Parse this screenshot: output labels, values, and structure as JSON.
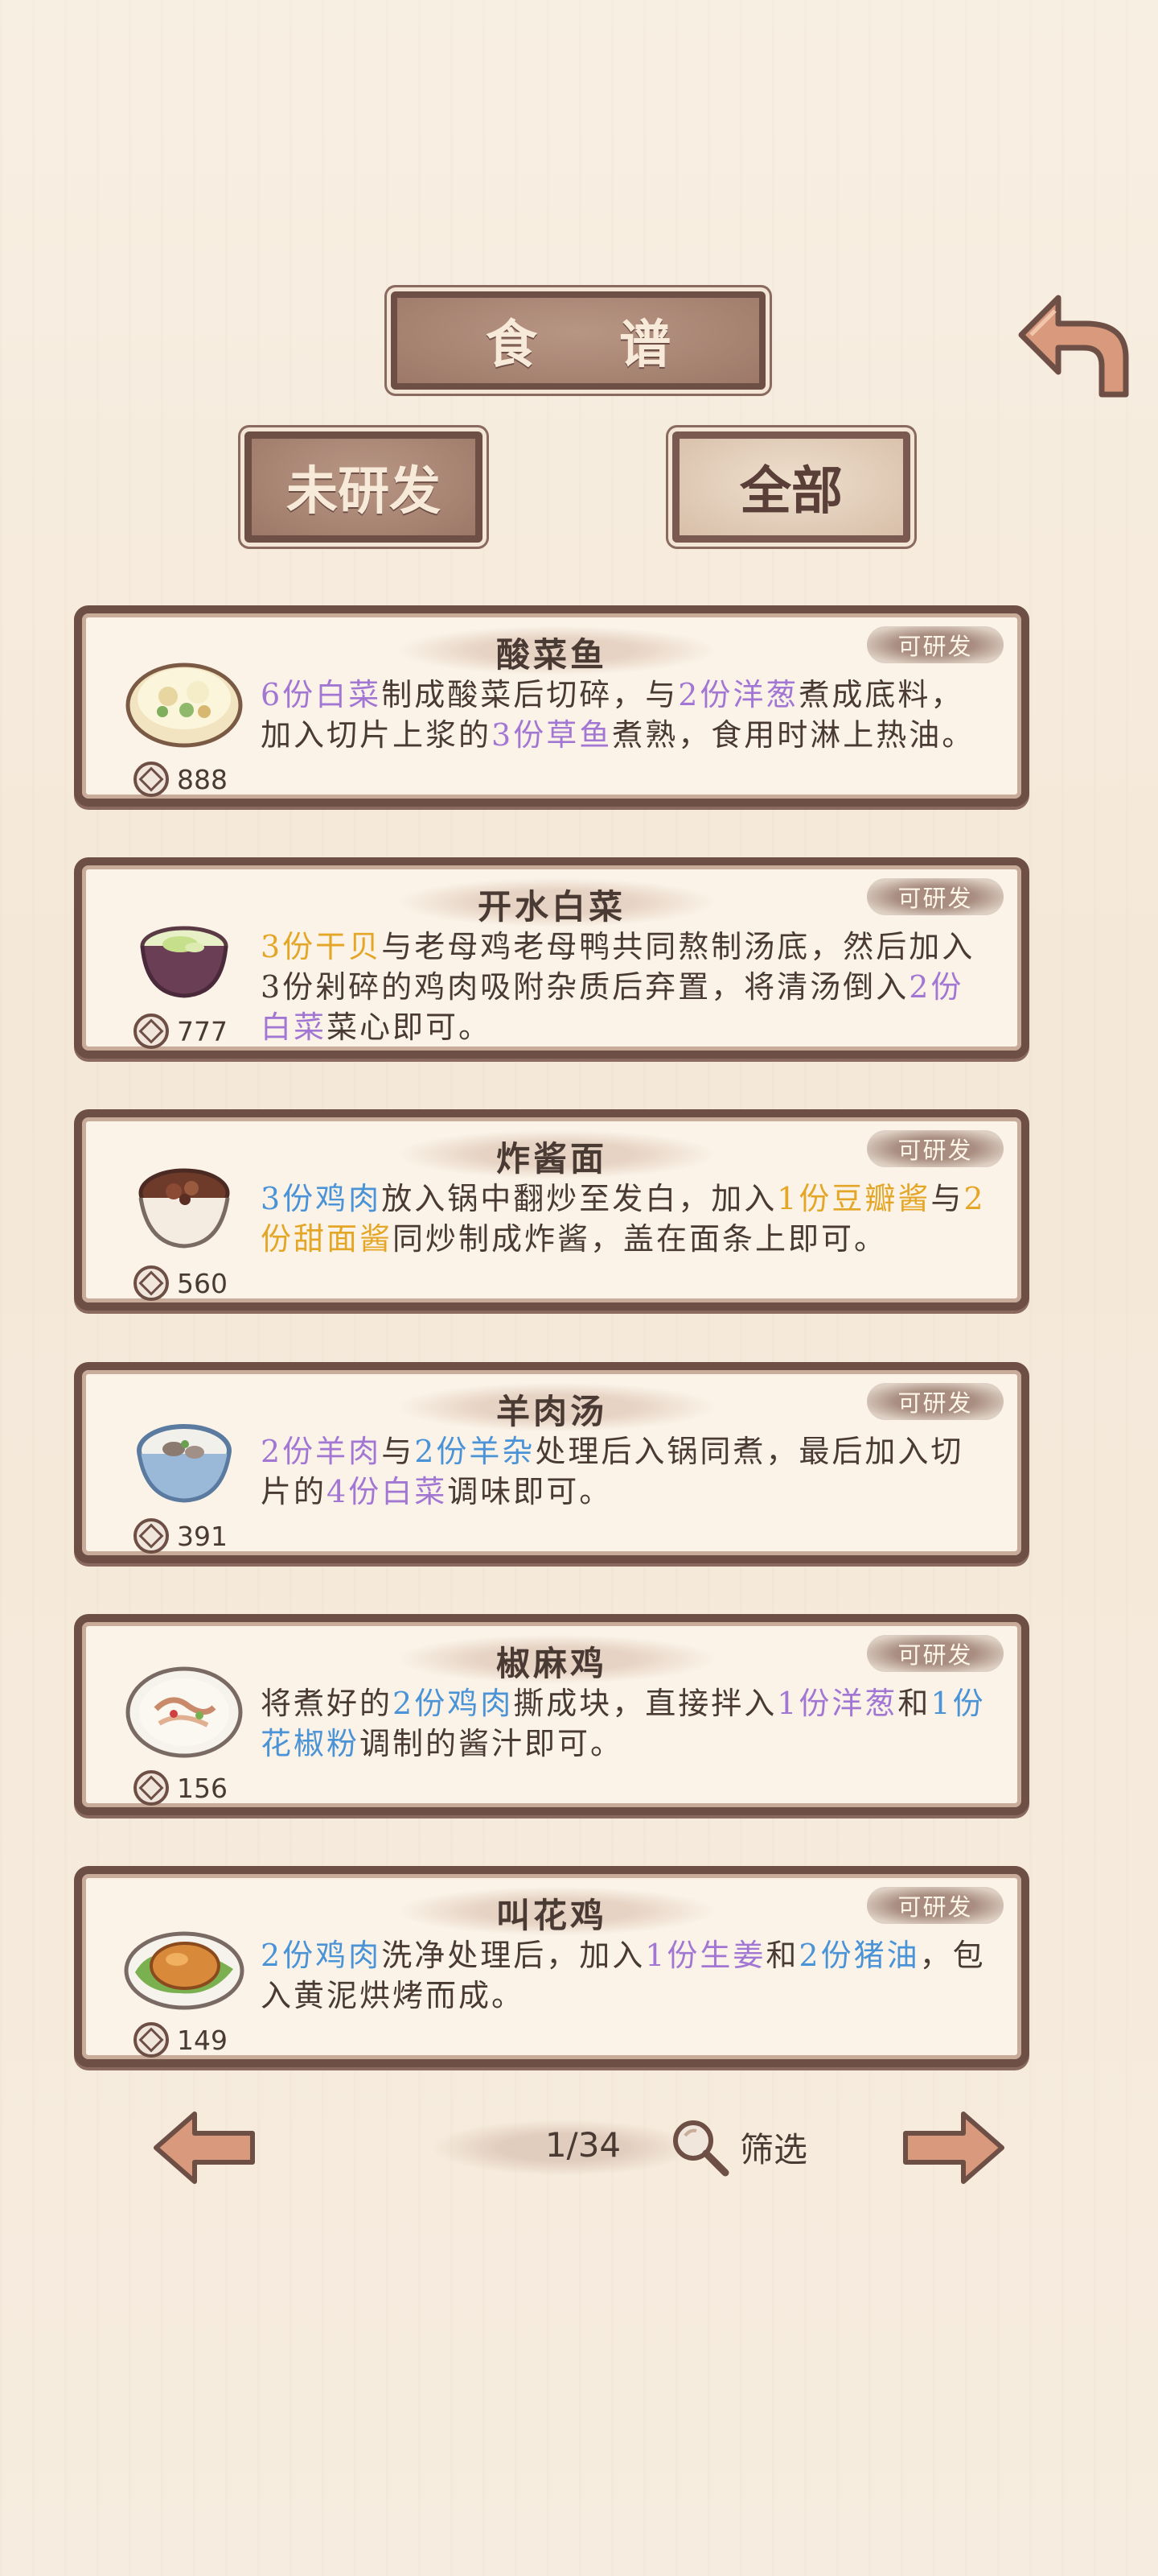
{
  "header": {
    "title": "食 谱",
    "back_icon": "back-arrow-icon"
  },
  "tabs": [
    {
      "label": "未研发",
      "selected": false
    },
    {
      "label": "全部",
      "selected": true
    }
  ],
  "recipes": [
    {
      "name": "酸菜鱼",
      "badge": "可研发",
      "cost": "888",
      "dish_icon": "sour-fish-pot-icon",
      "desc": [
        {
          "t": "6份白菜",
          "c": "purple"
        },
        {
          "t": "制成酸菜后切碎，与",
          "c": ""
        },
        {
          "t": "2份洋葱",
          "c": "purple"
        },
        {
          "t": "煮成底料，加入切片上浆的",
          "c": ""
        },
        {
          "t": "3份草鱼",
          "c": "purple"
        },
        {
          "t": "煮熟，食用时淋上热油。",
          "c": ""
        }
      ]
    },
    {
      "name": "开水白菜",
      "badge": "可研发",
      "cost": "777",
      "dish_icon": "cabbage-soup-bowl-icon",
      "desc": [
        {
          "t": "3份干贝",
          "c": "yellow"
        },
        {
          "t": "与老母鸡老母鸭共同熬制汤底，然后加入3份剁碎的鸡肉吸附杂质后弃置，将清汤倒入",
          "c": ""
        },
        {
          "t": "2份白菜",
          "c": "purple"
        },
        {
          "t": "菜心即可。",
          "c": ""
        }
      ]
    },
    {
      "name": "炸酱面",
      "badge": "可研发",
      "cost": "560",
      "dish_icon": "noodle-bowl-icon",
      "desc": [
        {
          "t": "3份鸡肉",
          "c": "blue"
        },
        {
          "t": "放入锅中翻炒至发白，加入",
          "c": ""
        },
        {
          "t": "1份豆瓣酱",
          "c": "yellow"
        },
        {
          "t": "与",
          "c": ""
        },
        {
          "t": "2份甜面酱",
          "c": "yellow"
        },
        {
          "t": "同炒制成炸酱，盖在面条上即可。",
          "c": ""
        }
      ]
    },
    {
      "name": "羊肉汤",
      "badge": "可研发",
      "cost": "391",
      "dish_icon": "mutton-soup-bowl-icon",
      "desc": [
        {
          "t": "2份羊肉",
          "c": "purple"
        },
        {
          "t": "与",
          "c": ""
        },
        {
          "t": "2份羊杂",
          "c": "blue"
        },
        {
          "t": "处理后入锅同煮，最后加入切片的",
          "c": ""
        },
        {
          "t": "4份白菜",
          "c": "purple"
        },
        {
          "t": "调味即可。",
          "c": ""
        }
      ]
    },
    {
      "name": "椒麻鸡",
      "badge": "可研发",
      "cost": "156",
      "dish_icon": "pepper-chicken-plate-icon",
      "desc": [
        {
          "t": "将煮好的",
          "c": ""
        },
        {
          "t": "2份鸡肉",
          "c": "blue"
        },
        {
          "t": "撕成块，直接拌入",
          "c": ""
        },
        {
          "t": "1份洋葱",
          "c": "purple"
        },
        {
          "t": "和",
          "c": ""
        },
        {
          "t": "1份花椒粉",
          "c": "blue"
        },
        {
          "t": "调制的酱汁即可。",
          "c": ""
        }
      ]
    },
    {
      "name": "叫花鸡",
      "badge": "可研发",
      "cost": "149",
      "dish_icon": "beggars-chicken-plate-icon",
      "desc": [
        {
          "t": "2份鸡肉",
          "c": "blue"
        },
        {
          "t": "洗净处理后，加入",
          "c": ""
        },
        {
          "t": "1份生姜",
          "c": "purple"
        },
        {
          "t": "和",
          "c": ""
        },
        {
          "t": "2份猪油",
          "c": "blue"
        },
        {
          "t": "，包入黄泥烘烤而成。",
          "c": ""
        }
      ]
    }
  ],
  "pager": {
    "page": "1/34",
    "filter_label": "筛选",
    "prev_icon": "left-arrow-icon",
    "next_icon": "right-arrow-icon",
    "filter_icon": "magnifier-icon"
  },
  "colors": {
    "frame": "#6e4f46",
    "purple": "#a277d3",
    "blue": "#4a93d6",
    "yellow": "#e4a627",
    "background": "#f6ecdf"
  }
}
